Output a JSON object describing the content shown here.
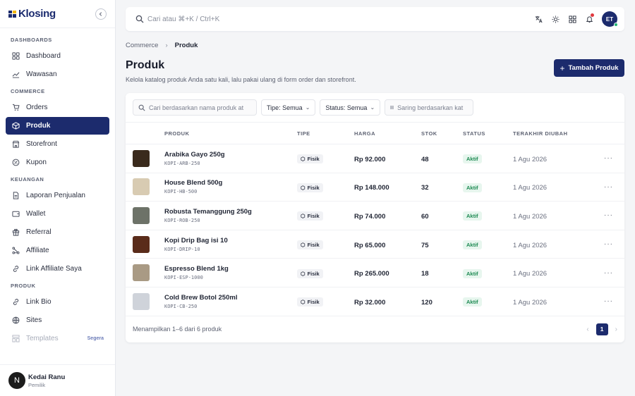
{
  "app": {
    "name": "Klosing",
    "brand_color": "#1c2b6d"
  },
  "sidebar": {
    "sections": [
      {
        "title": "DASHBOARDS",
        "items": [
          {
            "label": "Dashboard",
            "icon": "grid-icon"
          },
          {
            "label": "Wawasan",
            "icon": "trend-icon"
          }
        ]
      },
      {
        "title": "COMMERCE",
        "items": [
          {
            "label": "Orders",
            "icon": "cart-icon"
          },
          {
            "label": "Produk",
            "icon": "box-icon",
            "active": true
          },
          {
            "label": "Storefront",
            "icon": "store-icon"
          },
          {
            "label": "Kupon",
            "icon": "coupon-icon"
          }
        ]
      },
      {
        "title": "KEUANGAN",
        "items": [
          {
            "label": "Laporan Penjualan",
            "icon": "report-icon"
          },
          {
            "label": "Wallet",
            "icon": "wallet-icon"
          },
          {
            "label": "Referral",
            "icon": "gift-icon"
          },
          {
            "label": "Affiliate",
            "icon": "network-icon"
          },
          {
            "label": "Link Affiliate Saya",
            "icon": "link-icon"
          }
        ]
      },
      {
        "title": "PRODUK",
        "items": [
          {
            "label": "Link Bio",
            "icon": "link-icon"
          },
          {
            "label": "Sites",
            "icon": "globe-icon"
          },
          {
            "label": "Templates",
            "icon": "template-icon",
            "disabled": true,
            "badge": "Segera"
          }
        ]
      }
    ],
    "user": {
      "initial": "N",
      "name": "Kedai Ranu",
      "role": "Pemilik"
    }
  },
  "topbar": {
    "search_placeholder": "Cari atau ⌘+K / Ctrl+K",
    "avatar_initials": "ET"
  },
  "breadcrumb": {
    "parent": "Commerce",
    "current": "Produk"
  },
  "header": {
    "title": "Produk",
    "subtitle": "Kelola katalog produk Anda satu kali, lalu pakai ulang di form order dan storefront.",
    "add_button": "Tambah Produk"
  },
  "filters": {
    "search_placeholder": "Cari berdasarkan nama produk at",
    "type_label": "Tipe: Semua",
    "status_label": "Status: Semua",
    "category_placeholder": "Saring berdasarkan kat"
  },
  "table": {
    "columns": [
      "PRODUK",
      "TIPE",
      "HARGA",
      "STOK",
      "STATUS",
      "TERAKHIR DIUBAH"
    ],
    "rows": [
      {
        "name": "Arabika Gayo 250g",
        "sku": "KOPI-ARB-250",
        "type": "Fisik",
        "price": "Rp 92.000",
        "stock": "48",
        "status": "Aktif",
        "updated": "1 Agu 2026",
        "thumb": "#3a2a1c"
      },
      {
        "name": "House Blend 500g",
        "sku": "KOPI-HB-500",
        "type": "Fisik",
        "price": "Rp 148.000",
        "stock": "32",
        "status": "Aktif",
        "updated": "1 Agu 2026",
        "thumb": "#d8cbb2"
      },
      {
        "name": "Robusta Temanggung 250g",
        "sku": "KOPI-ROB-250",
        "type": "Fisik",
        "price": "Rp 74.000",
        "stock": "60",
        "status": "Aktif",
        "updated": "1 Agu 2026",
        "thumb": "#6d7268"
      },
      {
        "name": "Kopi Drip Bag isi 10",
        "sku": "KOPI-DRIP-10",
        "type": "Fisik",
        "price": "Rp 65.000",
        "stock": "75",
        "status": "Aktif",
        "updated": "1 Agu 2026",
        "thumb": "#5a2c1a"
      },
      {
        "name": "Espresso Blend 1kg",
        "sku": "KOPI-ESP-1000",
        "type": "Fisik",
        "price": "Rp 265.000",
        "stock": "18",
        "status": "Aktif",
        "updated": "1 Agu 2026",
        "thumb": "#a99a84"
      },
      {
        "name": "Cold Brew Botol 250ml",
        "sku": "KOPI-CB-250",
        "type": "Fisik",
        "price": "Rp 32.000",
        "stock": "120",
        "status": "Aktif",
        "updated": "1 Agu 2026",
        "thumb": "#cfd3da"
      }
    ]
  },
  "footer": {
    "summary": "Menampilkan 1–6 dari 6 produk",
    "page": "1"
  }
}
